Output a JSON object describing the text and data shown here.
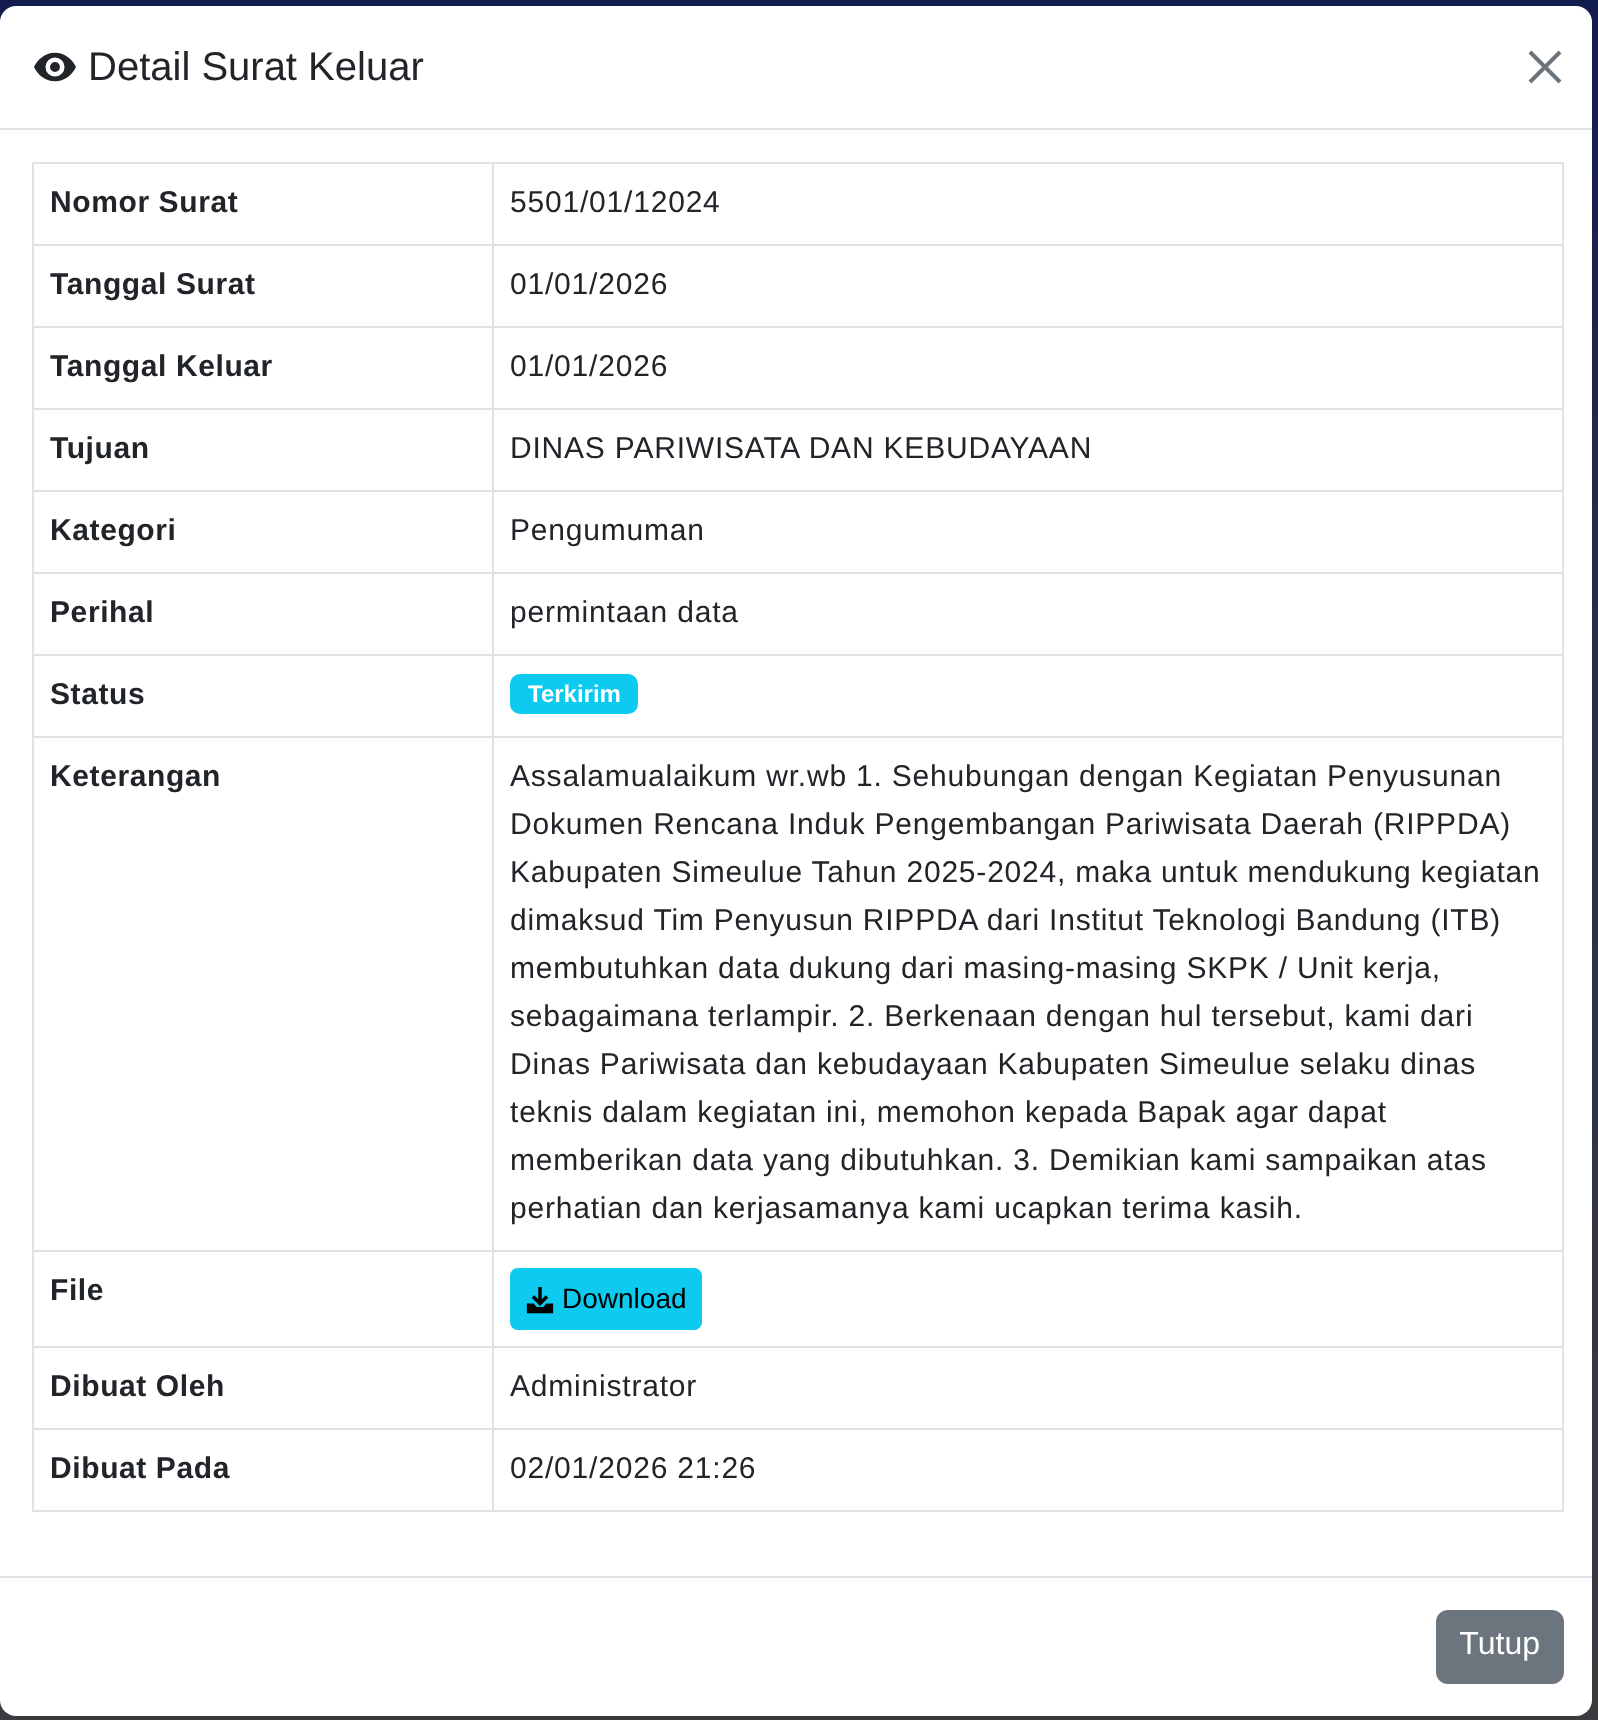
{
  "modal": {
    "title": "Detail Surat Keluar"
  },
  "details": [
    {
      "label": "Nomor Surat",
      "kind": "text",
      "value": "5501/01/12024"
    },
    {
      "label": "Tanggal Surat",
      "kind": "text",
      "value": "01/01/2026"
    },
    {
      "label": "Tanggal Keluar",
      "kind": "text",
      "value": "01/01/2026"
    },
    {
      "label": "Tujuan",
      "kind": "text",
      "value": "DINAS PARIWISATA DAN KEBUDAYAAN"
    },
    {
      "label": "Kategori",
      "kind": "text",
      "value": "Pengumuman"
    },
    {
      "label": "Perihal",
      "kind": "text",
      "value": "permintaan data"
    },
    {
      "label": "Status",
      "kind": "badge",
      "value": "Terkirim"
    },
    {
      "label": "Keterangan",
      "kind": "text",
      "value": "Assalamualaikum wr.wb 1. Sehubungan dengan Kegiatan Penyusunan Dokumen Rencana Induk Pengembangan Pariwisata Daerah (RIPPDA) Kabupaten Simeulue Tahun 2025-2024, maka untuk mendukung kegiatan dimaksud Tim Penyusun RIPPDA dari Institut Teknologi Bandung (ITB) membutuhkan data dukung dari masing-masing SKPK / Unit kerja, sebagaimana terlampir. 2. Berkenaan dengan hul tersebut, kami dari Dinas Pariwisata dan kebudayaan Kabupaten Simeulue selaku dinas teknis dalam kegiatan ini, memohon kepada Bapak agar dapat memberikan data yang dibutuhkan. 3. Demikian kami sampaikan atas perhatian dan kerjasamanya kami ucapkan terima kasih."
    },
    {
      "label": "File",
      "kind": "button",
      "value": "Download"
    },
    {
      "label": "Dibuat Oleh",
      "kind": "text",
      "value": "Administrator"
    },
    {
      "label": "Dibuat Pada",
      "kind": "text",
      "value": "02/01/2026 21:26"
    }
  ],
  "footer": {
    "buttons": [
      "Tutup"
    ]
  }
}
